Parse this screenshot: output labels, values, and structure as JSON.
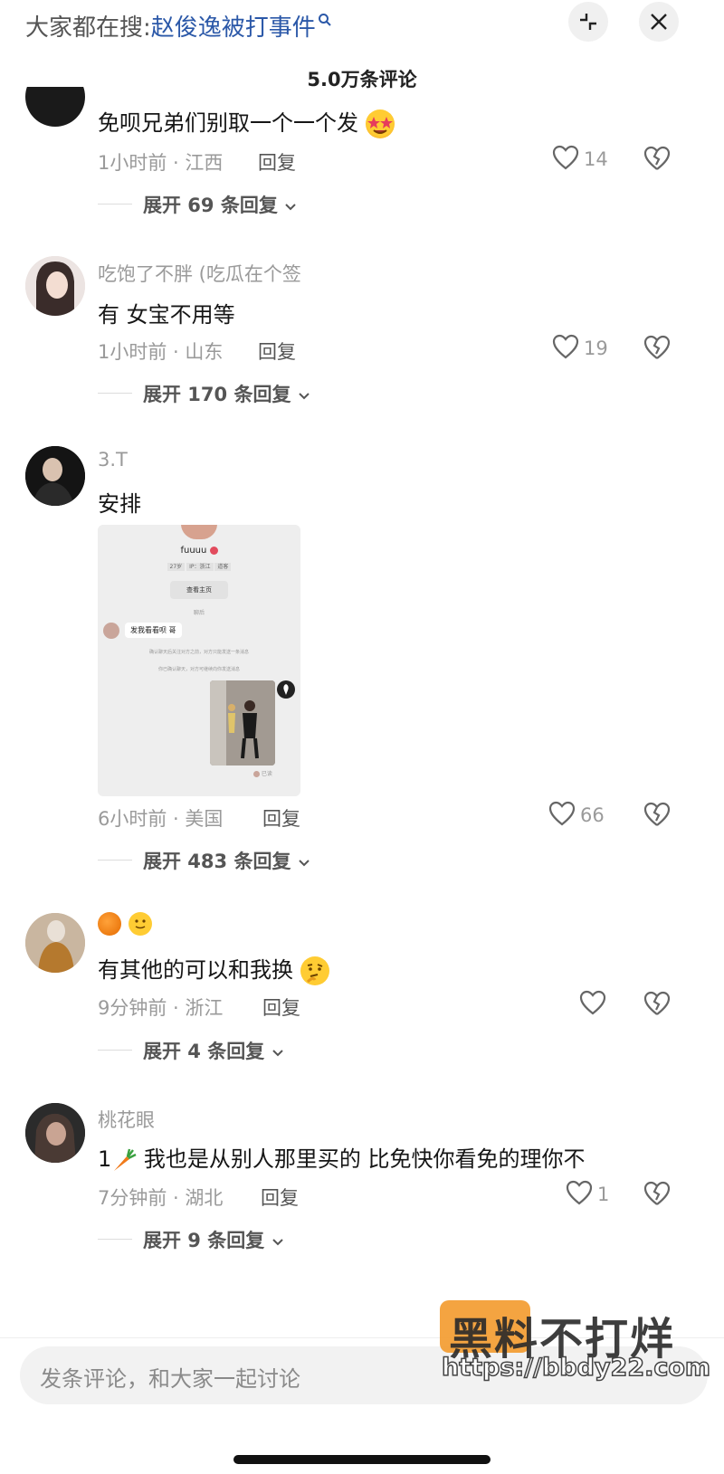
{
  "topbar": {
    "prefix": "大家都在搜:",
    "keyword": "赵俊逸被打事件",
    "search_icon": "search-icon",
    "collapse_icon": "collapse-icon",
    "close_icon": "close-icon"
  },
  "header": {
    "count_label": "5.0万条评论"
  },
  "comments": [
    {
      "text": "免呗兄弟们别取一个一个发",
      "emoji": "star-struck-emoji",
      "meta": "1小时前 · 江西",
      "reply": "回复",
      "likes": "14",
      "expand": "展开 69 条回复"
    },
    {
      "name": "吃饱了不胖 (吃瓜在个签",
      "text": "有 女宝不用等",
      "meta": "1小时前 · 山东",
      "reply": "回复",
      "likes": "19",
      "expand": "展开 170 条回复"
    },
    {
      "name": "3.T",
      "text": "安排",
      "meta": "6小时前 · 美国",
      "reply": "回复",
      "likes": "66",
      "expand": "展开 483 条回复",
      "attachment": {
        "profile_name": "fuuuu",
        "tags": [
          "27岁",
          "IP：浙江",
          "道客"
        ],
        "button": "查看主页",
        "divider_text": "聊后",
        "bubble": "发我看看呗 哥",
        "notice1": "确认聊天后关注对方之前，对方只能发送一条消息",
        "notice2": "你已确认聊天，对方可继续向你发送消息",
        "status": "已读"
      }
    },
    {
      "name_emojis": [
        "orange-emoji",
        "smile-emoji"
      ],
      "text": "有其他的可以和我换",
      "emoji": "thinking-emoji",
      "meta": "9分钟前 · 浙江",
      "reply": "回复",
      "likes": "",
      "expand": "展开 4 条回复"
    },
    {
      "name": "桃花眼",
      "text_prefix": "1",
      "text_emoji": "carrot-emoji",
      "text": "我也是从别人那里买的 比免快你看免的理你不",
      "meta": "7分钟前 · 湖北",
      "reply": "回复",
      "likes": "1",
      "expand": "展开 9 条回复"
    }
  ],
  "bottom": {
    "input_placeholder": "发条评论，和大家一起讨论",
    "watermark_text": "黑料不打烊",
    "watermark_url": "https://bbdy22.com"
  },
  "colors": {
    "keyword": "#2b58a8",
    "muted": "#9a9a9a",
    "text": "#161616"
  }
}
